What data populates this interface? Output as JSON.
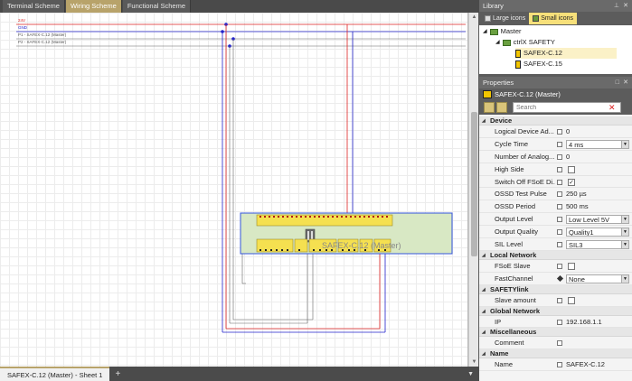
{
  "tabs": [
    {
      "label": "Terminal Scheme",
      "active": false
    },
    {
      "label": "Wiring Scheme",
      "active": true
    },
    {
      "label": "Functional Scheme",
      "active": false
    }
  ],
  "rails": [
    {
      "label": "24V",
      "color": "#d22"
    },
    {
      "label": "GND",
      "color": "#22c"
    },
    {
      "label": "P1 - SAFEX-C.12 (Master)",
      "color": "#555"
    },
    {
      "label": "P2 - SAFEX-C.12 (Master)",
      "color": "#555"
    }
  ],
  "device": {
    "label": "SAFEX-C.12 (Master)"
  },
  "sheet_tab": "SAFEX-C.12 (Master) - Sheet 1",
  "library": {
    "title": "Library",
    "tabs": [
      {
        "label": "Large icons",
        "active": false
      },
      {
        "label": "Small icons",
        "active": true
      }
    ],
    "tree": [
      {
        "label": "Master"
      },
      {
        "label": "ctrlX SAFETY"
      },
      {
        "label": "SAFEX-C.12",
        "selected": true
      },
      {
        "label": "SAFEX-C.15"
      }
    ]
  },
  "properties": {
    "title": "Properties",
    "header": "SAFEX-C.12 (Master)",
    "search_placeholder": "Search",
    "categories": [
      {
        "name": "Device",
        "rows": [
          {
            "name": "Logical Device Ad...",
            "value": "0",
            "kind": "text"
          },
          {
            "name": "Cycle Time",
            "value": "4 ms",
            "kind": "dropdown"
          },
          {
            "name": "Number of Analog...",
            "value": "0",
            "kind": "text"
          },
          {
            "name": "High Side",
            "value": "",
            "kind": "checkbox",
            "checked": false
          },
          {
            "name": "Switch Off FSoE Di...",
            "value": "✓",
            "kind": "checkbox",
            "checked": true
          },
          {
            "name": "OSSD Test Pulse",
            "value": "250 µs",
            "kind": "text"
          },
          {
            "name": "OSSD Period",
            "value": "500 ms",
            "kind": "text"
          },
          {
            "name": "Output Level",
            "value": "Low Level 5V",
            "kind": "dropdown"
          },
          {
            "name": "Output Quality",
            "value": "Quality1",
            "kind": "dropdown"
          },
          {
            "name": "SIL Level",
            "value": "SIL3",
            "kind": "dropdown"
          }
        ]
      },
      {
        "name": "Local Network",
        "rows": [
          {
            "name": "FSoE Slave",
            "value": "",
            "kind": "checkbox",
            "checked": false
          },
          {
            "name": "FastChannel",
            "value": "None",
            "kind": "dropdown",
            "diamond": true
          }
        ]
      },
      {
        "name": "SAFETYlink",
        "rows": [
          {
            "name": "Slave amount",
            "value": "",
            "kind": "checkbox",
            "checked": false
          }
        ]
      },
      {
        "name": "Global Network",
        "rows": [
          {
            "name": "IP",
            "value": "192.168.1.1",
            "kind": "text"
          }
        ]
      },
      {
        "name": "Miscellaneous",
        "rows": [
          {
            "name": "Comment",
            "value": "",
            "kind": "text"
          }
        ]
      },
      {
        "name": "Name",
        "rows": [
          {
            "name": "Name",
            "value": "SAFEX-C.12",
            "kind": "text"
          }
        ]
      }
    ]
  }
}
